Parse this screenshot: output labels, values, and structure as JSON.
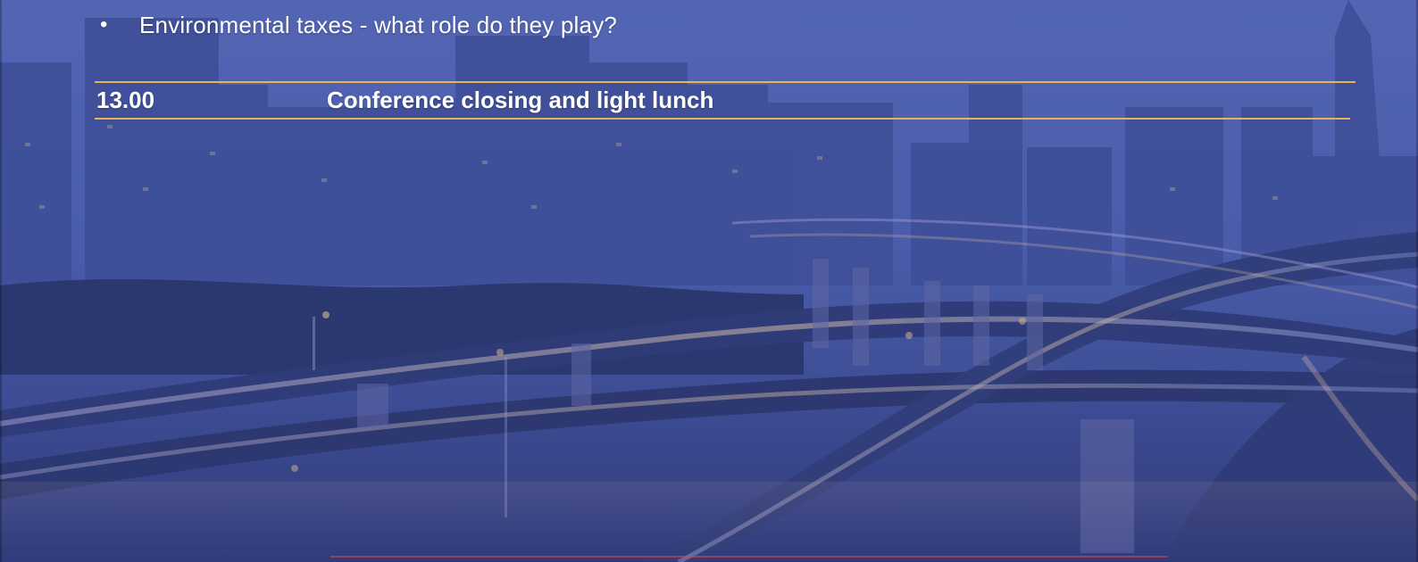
{
  "agenda": {
    "bullet": "•",
    "bullet_text": "Environmental taxes - what role do they play?",
    "time": "13.00",
    "item_title": "Conference closing and light lunch"
  },
  "colors": {
    "accent_rule": "#f2b84b",
    "text": "#ffffff",
    "overlay": "#4b5fa6"
  },
  "background": {
    "description_icon": "city-highway-night-photo"
  }
}
